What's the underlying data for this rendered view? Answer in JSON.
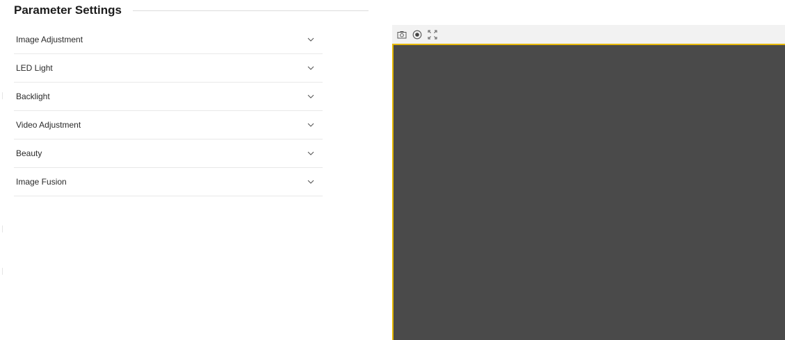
{
  "panel": {
    "title": "Parameter Settings"
  },
  "accordion": {
    "items": [
      {
        "label": "Image Adjustment"
      },
      {
        "label": "LED Light"
      },
      {
        "label": "Backlight"
      },
      {
        "label": "Video Adjustment"
      },
      {
        "label": "Beauty"
      },
      {
        "label": "Image Fusion"
      }
    ]
  },
  "preview": {
    "toolbar": {
      "icons": [
        "camera-icon",
        "record-icon",
        "fullscreen-icon"
      ]
    },
    "colors": {
      "video_background": "#4a4a4a",
      "selection_border": "#e6b800",
      "toolbar_background": "#f2f2f2"
    }
  }
}
